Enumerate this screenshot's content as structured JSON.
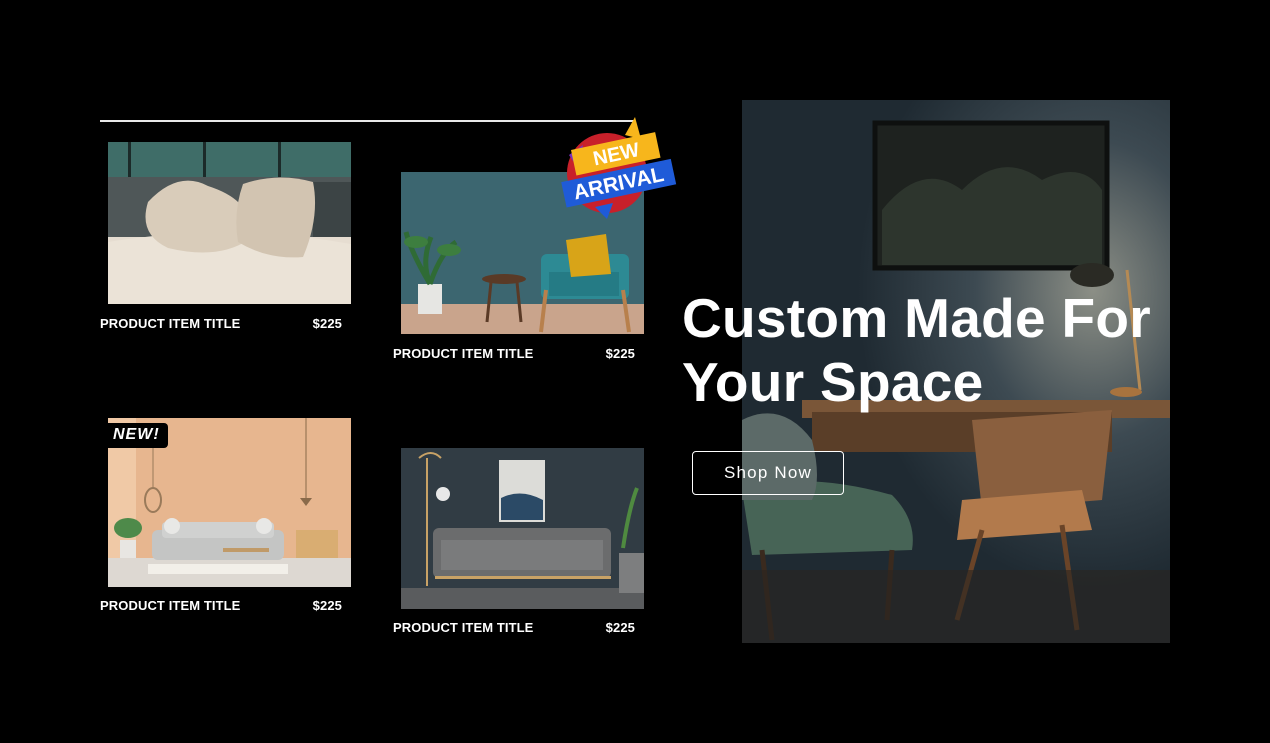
{
  "products": [
    {
      "title": "PRODUCT ITEM TITLE",
      "price": "$225"
    },
    {
      "title": "PRODUCT ITEM TITLE",
      "price": "$225"
    },
    {
      "title": "PRODUCT ITEM TITLE",
      "price": "$225"
    },
    {
      "title": "PRODUCT ITEM TITLE",
      "price": "$225"
    }
  ],
  "badges": {
    "new": "NEW!",
    "sticker_line1": "NEW",
    "sticker_line2": "ARRIVAL"
  },
  "hero": {
    "headline": "Custom Made For Your Space",
    "cta": "Shop Now"
  },
  "colors": {
    "background": "#000000",
    "text": "#ffffff",
    "sticker_yellow": "#f7b61c",
    "sticker_blue": "#1f5bd8",
    "sticker_red": "#c8202a"
  }
}
